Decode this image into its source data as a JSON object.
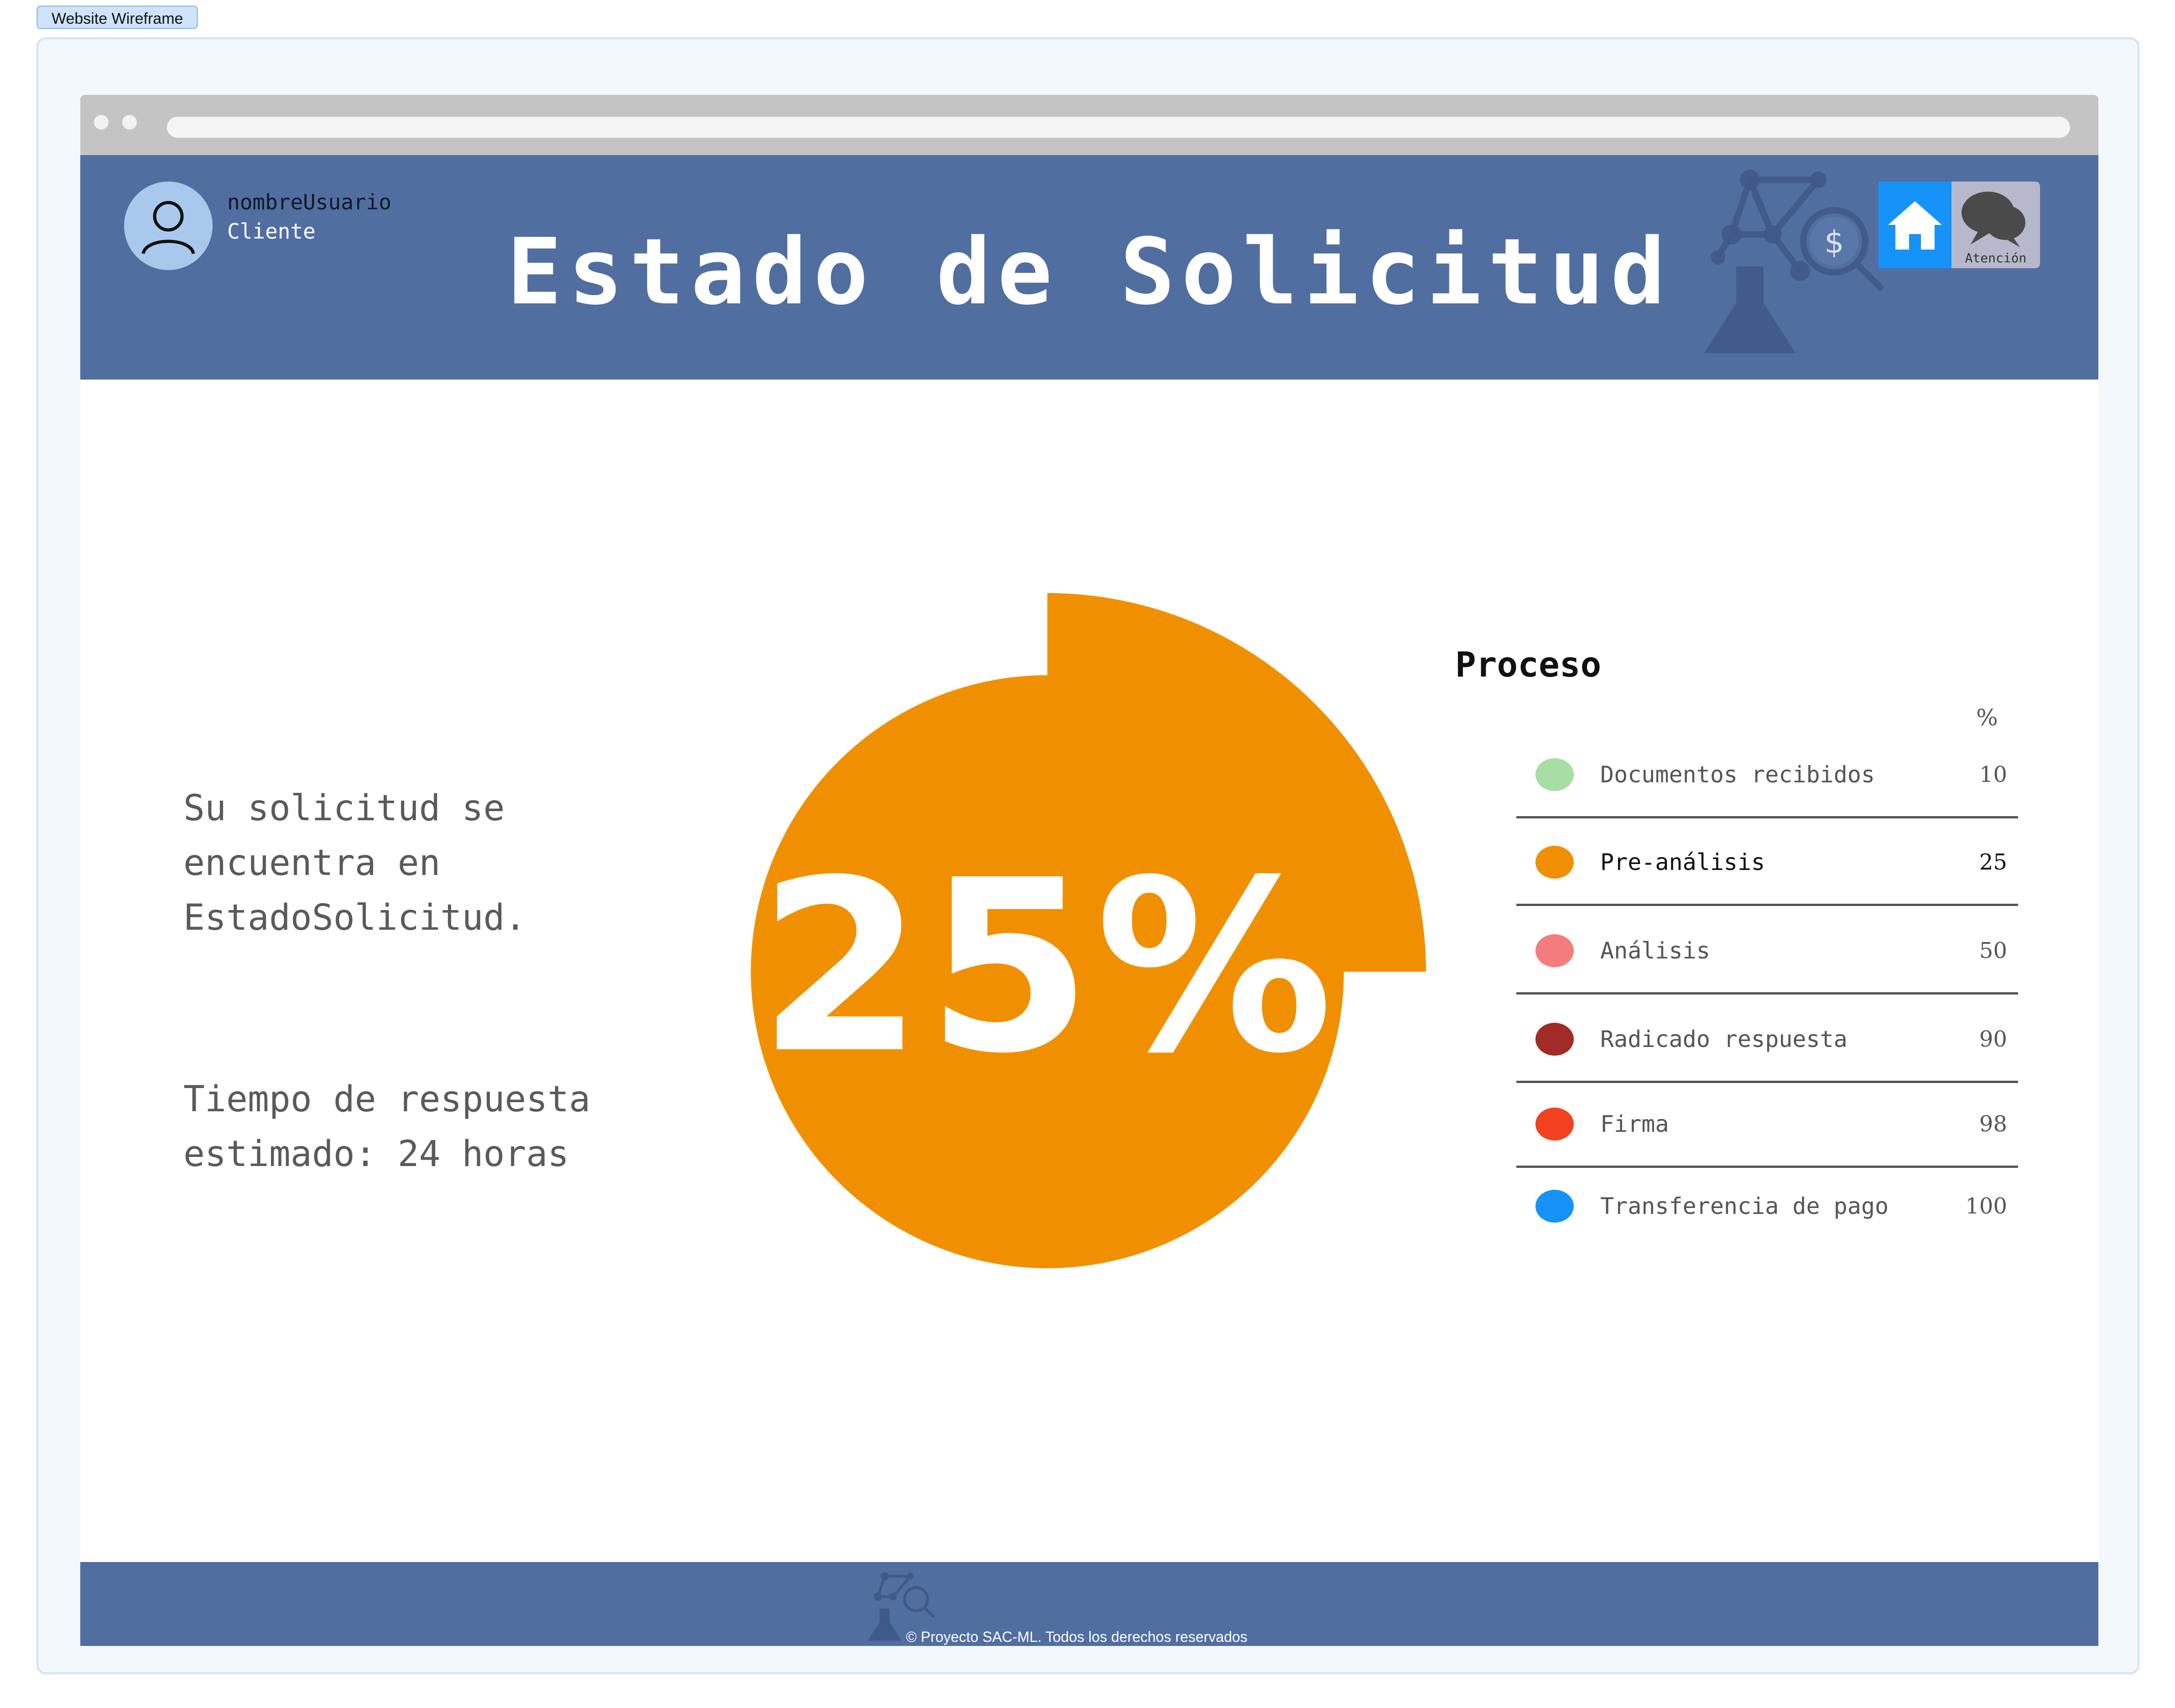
{
  "frame_label": "Website Wireframe",
  "user": {
    "name": "nombreUsuario",
    "role": "Cliente"
  },
  "header": {
    "title": "Estado de Solicitud",
    "atencion_label": "Atención"
  },
  "status": {
    "message": "Su solicitud se encuentra en EstadoSolicitud.",
    "response_time": "Tiempo de respuesta estimado: 24 horas"
  },
  "progress": {
    "value": 25,
    "label": "25%",
    "color": "#f09000"
  },
  "process": {
    "title": "Proceso",
    "percent_header": "%",
    "steps": [
      {
        "label": "Documentos recibidos",
        "value": "10",
        "color": "#a7dea4"
      },
      {
        "label": "Pre-análisis",
        "value": "25",
        "color": "#f09000"
      },
      {
        "label": "Análisis",
        "value": "50",
        "color": "#f47c7c"
      },
      {
        "label": "Radicado respuesta",
        "value": "90",
        "color": "#a12b27"
      },
      {
        "label": "Firma",
        "value": "98",
        "color": "#f1411e"
      },
      {
        "label": "Transferencia de pago",
        "value": "100",
        "color": "#1593f8"
      }
    ]
  },
  "footer": {
    "copyright": "© Proyecto SAC-ML. Todos los derechos reservados"
  },
  "icons": {
    "avatar": "user-icon",
    "home": "home-icon",
    "chat": "chat-bubbles-icon",
    "logo": "lab-network-logo-icon"
  }
}
